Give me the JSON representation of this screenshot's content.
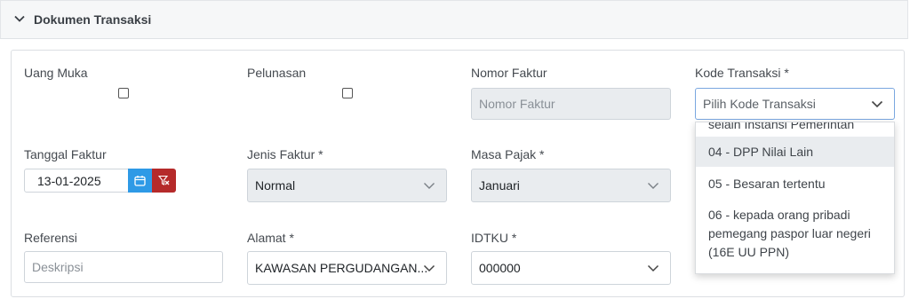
{
  "section": {
    "title": "Dokumen Transaksi"
  },
  "fields": {
    "uang_muka": {
      "label": "Uang Muka"
    },
    "pelunasan": {
      "label": "Pelunasan"
    },
    "nomor_faktur": {
      "label": "Nomor Faktur",
      "placeholder": "Nomor Faktur"
    },
    "kode_transaksi": {
      "label": "Kode Transaksi *",
      "placeholder": "Pilih Kode Transaksi"
    },
    "tanggal_faktur": {
      "label": "Tanggal Faktur",
      "value": "13-01-2025"
    },
    "jenis_faktur": {
      "label": "Jenis Faktur *",
      "value": "Normal"
    },
    "masa_pajak": {
      "label": "Masa Pajak *",
      "value": "Januari"
    },
    "referensi": {
      "label": "Referensi",
      "placeholder": "Deskripsi"
    },
    "alamat": {
      "label": "Alamat *",
      "value": "KAWASAN PERGUDANGAN..."
    },
    "idtku": {
      "label": "IDTKU *",
      "value": "000000"
    }
  },
  "kode_dropdown": {
    "options": [
      {
        "text": "selain Instansi Pemerintah",
        "highlighted": false
      },
      {
        "text": "04 - DPP Nilai Lain",
        "highlighted": true
      },
      {
        "text": "05 - Besaran tertentu",
        "highlighted": false
      },
      {
        "text": "06 - kepada orang pribadi pemegang paspor luar negeri (16E UU PPN)",
        "highlighted": false
      }
    ]
  },
  "colors": {
    "calendar_button": "#2e9ae6",
    "clear_button": "#b52a2a",
    "highlight": "#e9ecef"
  },
  "icons": {
    "section_toggle": "chevron-down-icon",
    "calendar": "calendar-icon",
    "clear": "filter-clear-icon",
    "select_caret": "chevron-down-icon"
  }
}
